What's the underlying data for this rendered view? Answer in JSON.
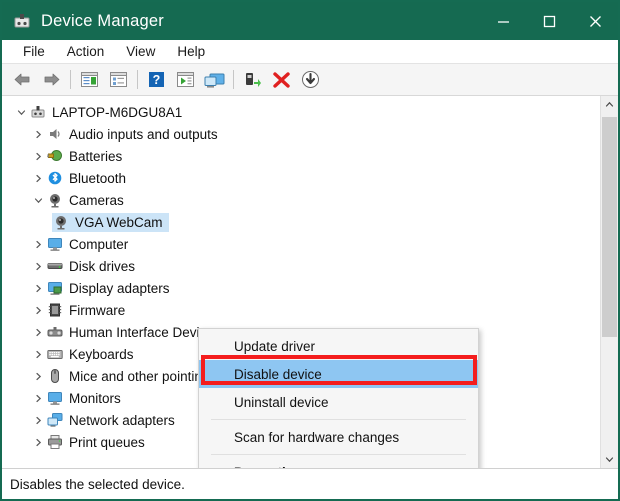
{
  "window": {
    "title": "Device Manager",
    "title_icon": "device-manager-icon",
    "controls": {
      "minimize": "minimize-icon",
      "maximize": "maximize-icon",
      "close": "close-icon"
    },
    "colors": {
      "titlebar": "#156a51",
      "selection": "#cce4f7",
      "menu_highlight": "#8ec6f2",
      "annotation": "#f41d1d"
    }
  },
  "menubar": {
    "items": [
      {
        "label": "File"
      },
      {
        "label": "Action"
      },
      {
        "label": "View"
      },
      {
        "label": "Help"
      }
    ]
  },
  "toolbar": {
    "buttons": [
      {
        "name": "back-icon"
      },
      {
        "name": "forward-icon"
      },
      {
        "name": "separator"
      },
      {
        "name": "properties-window-icon"
      },
      {
        "name": "list-view-icon"
      },
      {
        "name": "separator"
      },
      {
        "name": "help-icon"
      },
      {
        "name": "play-window-icon"
      },
      {
        "name": "monitor-icon"
      },
      {
        "name": "separator"
      },
      {
        "name": "scan-hardware-icon"
      },
      {
        "name": "uninstall-device-icon"
      },
      {
        "name": "disable-device-icon"
      }
    ]
  },
  "tree": {
    "root": {
      "label": "LAPTOP-M6DGU8A1",
      "icon": "computer-icon",
      "expanded": true
    },
    "items": [
      {
        "label": "Audio inputs and outputs",
        "icon": "speaker-icon",
        "expanded": false,
        "selected": false
      },
      {
        "label": "Batteries",
        "icon": "battery-icon",
        "expanded": false,
        "selected": false
      },
      {
        "label": "Bluetooth",
        "icon": "bluetooth-icon",
        "expanded": false,
        "selected": false
      },
      {
        "label": "Cameras",
        "icon": "camera-icon",
        "expanded": true,
        "selected": false
      },
      {
        "label": "VGA WebCam",
        "icon": "camera-icon",
        "child": true,
        "selected": true
      },
      {
        "label": "Computer",
        "icon": "monitor-icon",
        "expanded": false,
        "selected": false
      },
      {
        "label": "Disk drives",
        "icon": "disk-icon",
        "expanded": false,
        "selected": false
      },
      {
        "label": "Display adapters",
        "icon": "display-adapter-icon",
        "expanded": false,
        "selected": false
      },
      {
        "label": "Firmware",
        "icon": "firmware-icon",
        "expanded": false,
        "selected": false
      },
      {
        "label": "Human Interface Devices",
        "icon": "hid-icon",
        "expanded": false,
        "selected": false
      },
      {
        "label": "Keyboards",
        "icon": "keyboard-icon",
        "expanded": false,
        "selected": false
      },
      {
        "label": "Mice and other pointing devices",
        "icon": "mouse-icon",
        "expanded": false,
        "selected": false
      },
      {
        "label": "Monitors",
        "icon": "monitor-icon",
        "expanded": false,
        "selected": false
      },
      {
        "label": "Network adapters",
        "icon": "network-adapter-icon",
        "expanded": false,
        "selected": false
      },
      {
        "label": "Print queues",
        "icon": "printer-icon",
        "expanded": false,
        "selected": false
      }
    ]
  },
  "context_menu": {
    "items": [
      {
        "label": "Update driver",
        "highlighted": false,
        "bold": false
      },
      {
        "label": "Disable device",
        "highlighted": true,
        "bold": false
      },
      {
        "label": "Uninstall device",
        "highlighted": false,
        "bold": false
      },
      {
        "separator": true
      },
      {
        "label": "Scan for hardware changes",
        "highlighted": false,
        "bold": false
      },
      {
        "separator": true
      },
      {
        "label": "Properties",
        "highlighted": false,
        "bold": true
      }
    ]
  },
  "statusbar": {
    "text": "Disables the selected device."
  }
}
